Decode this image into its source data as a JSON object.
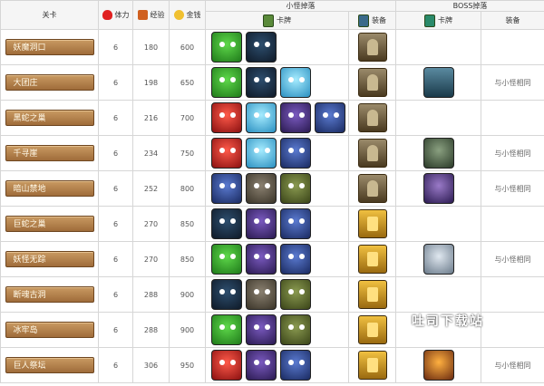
{
  "header": {
    "level": "关卡",
    "stamina": "体力",
    "exp": "经验",
    "gold": "金钱",
    "minion_group": "小怪掉落",
    "boss_group": "BOSS掉落",
    "minion_card": "卡牌",
    "minion_equip": "装备",
    "boss_card": "卡牌",
    "boss_equip": "装备"
  },
  "icons": {
    "stamina": "heart-icon",
    "exp": "exp-icon",
    "gold": "coin-icon",
    "card": "card-book-icon",
    "equip": "equip-book-icon",
    "boss_card": "boss-card-book-icon"
  },
  "rows": [
    {
      "level": "妖魔洞口",
      "stamina": "6",
      "exp": "180",
      "gold": "600",
      "boss_equip": ""
    },
    {
      "level": "大团庄",
      "stamina": "6",
      "exp": "198",
      "gold": "650",
      "boss_equip": "与小怪相同"
    },
    {
      "level": "黑蛇之巢",
      "stamina": "6",
      "exp": "216",
      "gold": "700",
      "boss_equip": ""
    },
    {
      "level": "千寻崖",
      "stamina": "6",
      "exp": "234",
      "gold": "750",
      "boss_equip": "与小怪相同"
    },
    {
      "level": "暗山禁地",
      "stamina": "6",
      "exp": "252",
      "gold": "800",
      "boss_equip": "与小怪相同"
    },
    {
      "level": "巨蛇之巢",
      "stamina": "6",
      "exp": "270",
      "gold": "850",
      "boss_equip": ""
    },
    {
      "level": "妖怪无踪",
      "stamina": "6",
      "exp": "270",
      "gold": "850",
      "boss_equip": "与小怪相同"
    },
    {
      "level": "断魂古洞",
      "stamina": "6",
      "exp": "288",
      "gold": "900",
      "boss_equip": ""
    },
    {
      "level": "冰牢岛",
      "stamina": "6",
      "exp": "288",
      "gold": "900",
      "boss_equip": ""
    },
    {
      "level": "巨人祭坛",
      "stamina": "6",
      "exp": "306",
      "gold": "950",
      "boss_equip": "与小怪相同"
    }
  ],
  "watermark": "吐司下载站"
}
